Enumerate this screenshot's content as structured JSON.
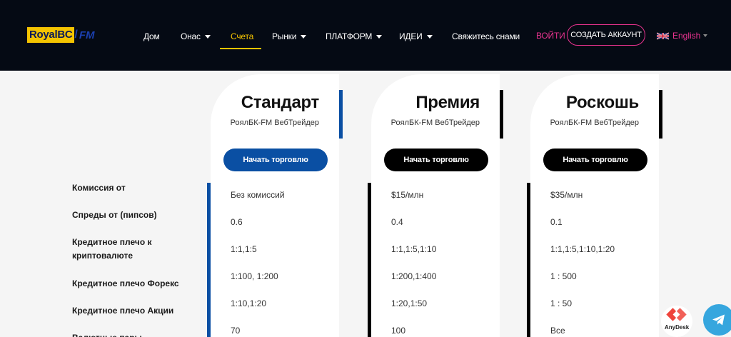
{
  "header": {
    "logo_main": "RoyalBC",
    "logo_fm": "FM",
    "nav": [
      {
        "label": "Дом",
        "has_caret": false,
        "active": false
      },
      {
        "label": "Онас",
        "has_caret": true,
        "active": false
      },
      {
        "label": "Счета",
        "has_caret": false,
        "active": true
      },
      {
        "label": "Рынки",
        "has_caret": true,
        "active": false
      },
      {
        "label": "ПЛАТФОРМ",
        "has_caret": true,
        "active": false
      },
      {
        "label": "ИДЕИ",
        "has_caret": true,
        "active": false
      },
      {
        "label": "Свяжитесь снами",
        "has_caret": false,
        "active": false
      }
    ],
    "login_label": "ВОЙТИ",
    "create_account_label": "СОЗДАТЬ АККАУНТ",
    "language": "English"
  },
  "row_labels": [
    "Комиссия от",
    "Спреды от (пипсов)",
    "Кредитное плечо к криптовалюте",
    "Кредитное плечо Форекс",
    "Кредитное плечо Акции",
    "Валютные пары"
  ],
  "plans": [
    {
      "title": "Стандарт",
      "platform": "РоялБК-FM ВебТрейдер",
      "button_label": "Начать торговлю",
      "accent_color": "#0a4fa3",
      "values": [
        "Без комиссий",
        "0.6",
        "1:1,1:5",
        "1:100, 1:200",
        "1:10,1:20",
        "70"
      ]
    },
    {
      "title": "Премия",
      "platform": "РоялБК-FM ВебТрейдер",
      "button_label": "Начать торговлю",
      "accent_color": "#000000",
      "values": [
        "$15/млн",
        "0.4",
        "1:1,1:5,1:10",
        "1:200,1:400",
        "1:20,1:50",
        "100"
      ]
    },
    {
      "title": "Роскошь",
      "platform": "РоялБК-FM ВебТрейдер",
      "button_label": "Начать торговлю",
      "accent_color": "#000000",
      "values": [
        "$35/млн",
        "0.1",
        "1:1,1:5,1:10,1:20",
        "1 : 500",
        "1 : 50",
        "Все"
      ]
    }
  ],
  "floating": {
    "anydesk_label": "AnyDesk",
    "anydesk_icon": "anydesk-icon",
    "telegram_icon": "telegram-icon"
  },
  "colors": {
    "header_bg": "#050a14",
    "accent_yellow": "#f4c400",
    "accent_pink": "#e8338f",
    "standard_blue": "#0a4fa3"
  }
}
